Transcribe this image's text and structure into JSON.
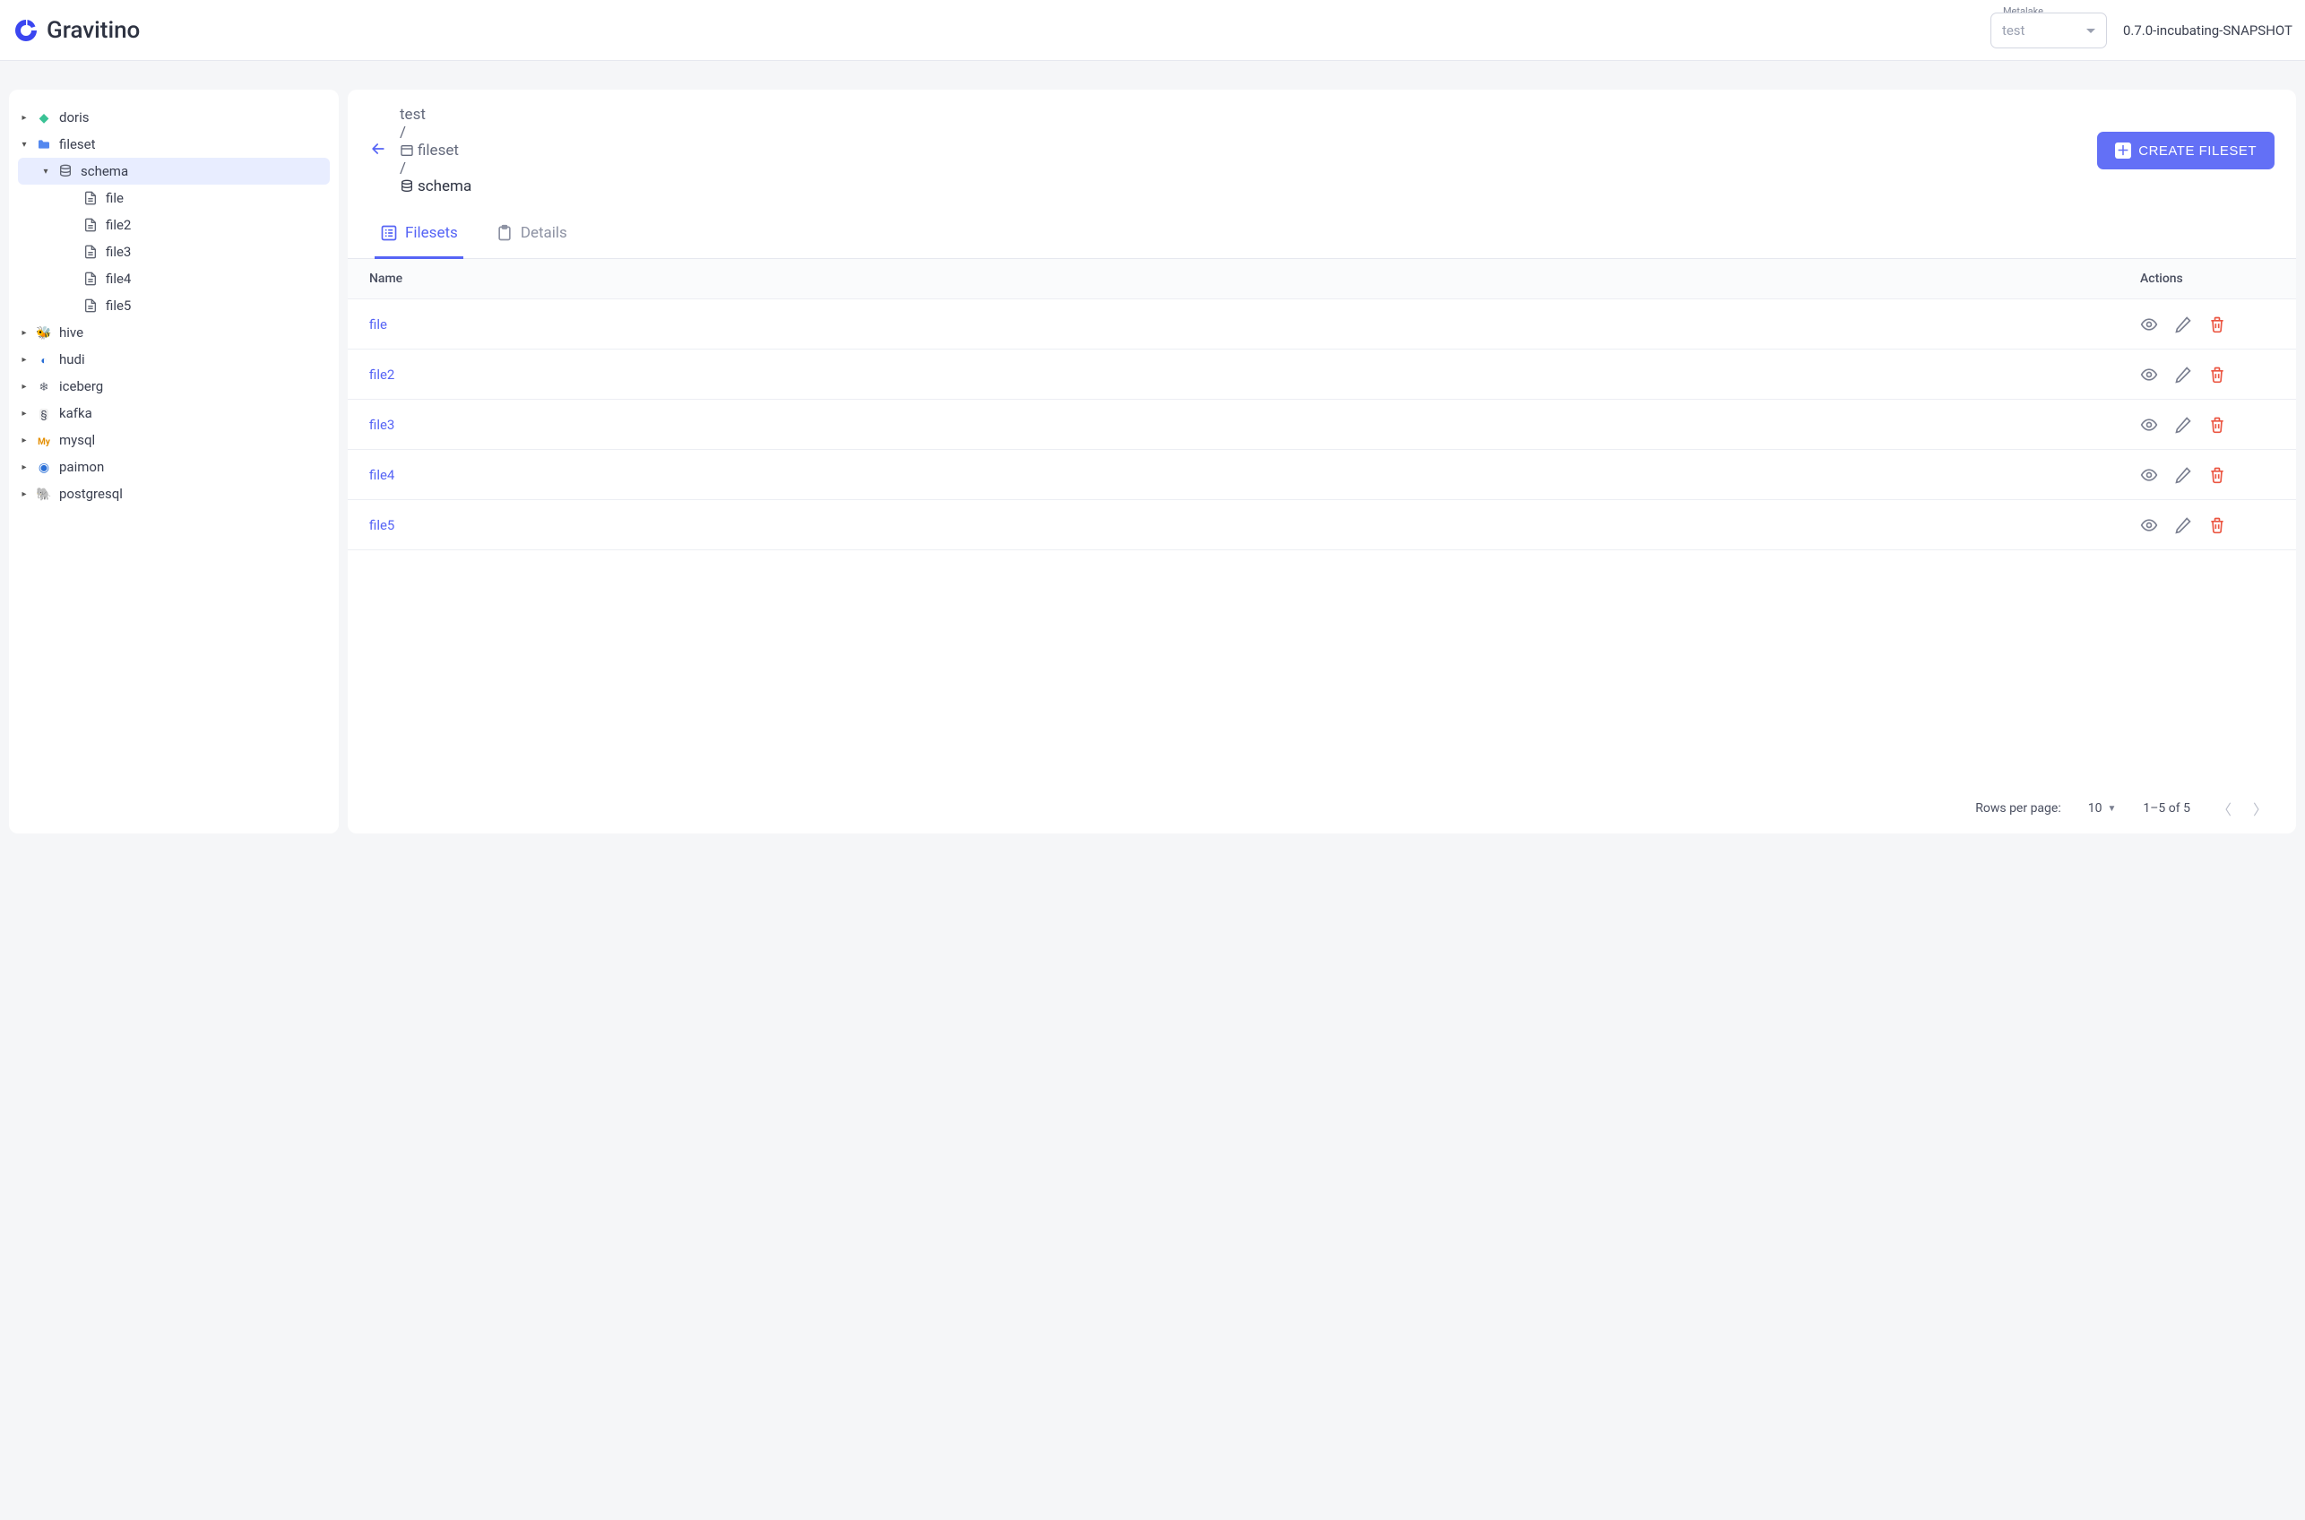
{
  "brand": {
    "name": "Gravitino"
  },
  "metalake": {
    "label": "Metalake",
    "value": "test"
  },
  "version": "0.7.0-incubating-SNAPSHOT",
  "sidebar": {
    "items": [
      {
        "label": "doris",
        "icon": "doris",
        "expandable": true,
        "expanded": false,
        "depth": 1
      },
      {
        "label": "fileset",
        "icon": "folder",
        "expandable": true,
        "expanded": true,
        "depth": 1
      },
      {
        "label": "schema",
        "icon": "db",
        "expandable": true,
        "expanded": true,
        "depth": 2,
        "selected": true
      },
      {
        "label": "file",
        "icon": "file",
        "depth": 3
      },
      {
        "label": "file2",
        "icon": "file",
        "depth": 3
      },
      {
        "label": "file3",
        "icon": "file",
        "depth": 3
      },
      {
        "label": "file4",
        "icon": "file",
        "depth": 3
      },
      {
        "label": "file5",
        "icon": "file",
        "depth": 3
      },
      {
        "label": "hive",
        "icon": "hive",
        "expandable": true,
        "expanded": false,
        "depth": 1
      },
      {
        "label": "hudi",
        "icon": "hudi",
        "expandable": true,
        "expanded": false,
        "depth": 1
      },
      {
        "label": "iceberg",
        "icon": "iceberg",
        "expandable": true,
        "expanded": false,
        "depth": 1
      },
      {
        "label": "kafka",
        "icon": "kafka",
        "expandable": true,
        "expanded": false,
        "depth": 1
      },
      {
        "label": "mysql",
        "icon": "mysql",
        "expandable": true,
        "expanded": false,
        "depth": 1
      },
      {
        "label": "paimon",
        "icon": "paimon",
        "expandable": true,
        "expanded": false,
        "depth": 1
      },
      {
        "label": "postgresql",
        "icon": "postgresql",
        "expandable": true,
        "expanded": false,
        "depth": 1
      }
    ]
  },
  "breadcrumb": {
    "items": [
      {
        "label": "test",
        "icon": null
      },
      {
        "label": "fileset",
        "icon": "fileset"
      },
      {
        "label": "schema",
        "icon": "db",
        "current": true
      }
    ]
  },
  "create_button": "CREATE FILESET",
  "tabs": [
    {
      "label": "Filesets",
      "active": true
    },
    {
      "label": "Details",
      "active": false
    }
  ],
  "table": {
    "columns": {
      "name": "Name",
      "actions": "Actions"
    },
    "rows": [
      {
        "name": "file"
      },
      {
        "name": "file2"
      },
      {
        "name": "file3"
      },
      {
        "name": "file4"
      },
      {
        "name": "file5"
      }
    ]
  },
  "pager": {
    "rows_per_page_label": "Rows per page:",
    "rows_per_page_value": "10",
    "range": "1–5 of 5"
  }
}
